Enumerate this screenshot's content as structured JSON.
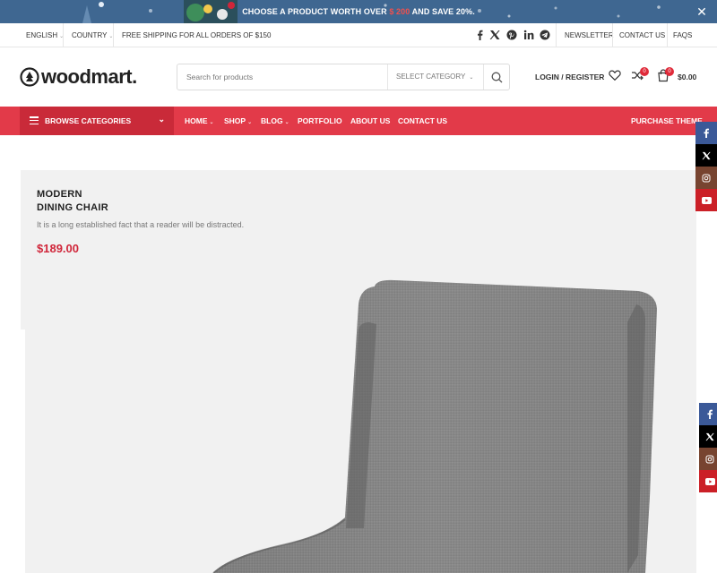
{
  "promo": {
    "text_before": "CHOOSE A PRODUCT WORTH OVER ",
    "amount": "$ 200",
    "text_after": " AND SAVE 20%."
  },
  "topbar": {
    "language": "ENGLISH",
    "country": "COUNTRY",
    "shipping": "FREE SHIPPING FOR ALL ORDERS OF $150",
    "links": [
      "NEWSLETTER",
      "CONTACT US",
      "FAQS"
    ],
    "social_icons": [
      "facebook-icon",
      "x-icon",
      "pinterest-icon",
      "linkedin-icon",
      "telegram-icon"
    ]
  },
  "header": {
    "logo": "woodmart.",
    "search_placeholder": "Search for products",
    "category_label": "SELECT CATEGORY",
    "login": "LOGIN / REGISTER",
    "compare_count": "0",
    "cart_count": "0",
    "cart_total": "$0.00"
  },
  "nav": {
    "browse": "BROWSE CATEGORIES",
    "items": [
      "HOME",
      "SHOP",
      "BLOG",
      "PORTFOLIO",
      "ABOUT US",
      "CONTACT US"
    ],
    "purchase": "PURCHASE THEME"
  },
  "sticky_social": [
    "facebook-icon",
    "x-icon",
    "instagram-icon",
    "youtube-icon"
  ],
  "product": {
    "title_line1": "MODERN",
    "title_line2": "DINING CHAIR",
    "description": "It is a long established fact that a reader will be distracted.",
    "price": "$189.00"
  },
  "colors": {
    "promo_bg": "#3f6791",
    "accent_red": "#e23a49",
    "browse_bg": "#c92a39",
    "price": "#d0263a",
    "facebook": "#3b5998",
    "x": "#000000",
    "instagram": "#774430",
    "youtube": "#cb2027"
  }
}
